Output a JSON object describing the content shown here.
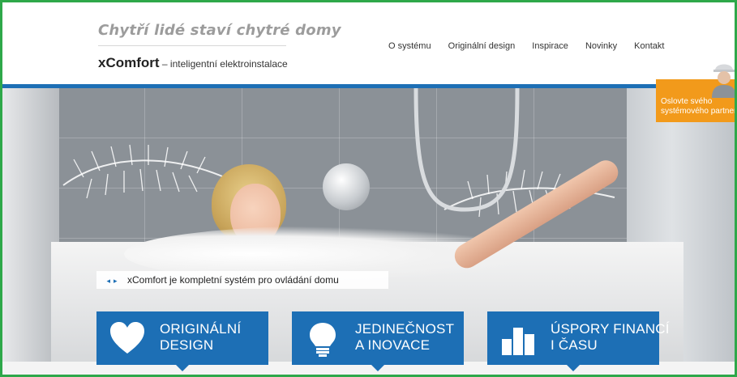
{
  "header": {
    "tagline": "Chytří lidé staví chytré domy",
    "brand_name": "xComfort",
    "brand_sub": " – inteligentní elektroinstalace"
  },
  "nav": {
    "items": [
      {
        "label": "O systému"
      },
      {
        "label": "Originální design"
      },
      {
        "label": "Inspirace"
      },
      {
        "label": "Novinky"
      },
      {
        "label": "Kontakt"
      }
    ]
  },
  "partner": {
    "line1": "Oslovte svého",
    "line2": "systémového partnera"
  },
  "hero": {
    "caption": "xComfort je kompletní systém pro ovládání domu"
  },
  "features": [
    {
      "line1": "ORIGINÁLNÍ",
      "line2": "DESIGN",
      "icon": "heart-icon"
    },
    {
      "line1": "JEDINEČNOST",
      "line2": "A INOVACE",
      "icon": "lightbulb-icon"
    },
    {
      "line1": "ÚSPORY FINANCÍ",
      "line2": "I ČASU",
      "icon": "bar-chart-icon"
    }
  ],
  "colors": {
    "accent_blue": "#1d6fb5",
    "partner_orange": "#f29a1b",
    "frame_green": "#2ea84a"
  }
}
